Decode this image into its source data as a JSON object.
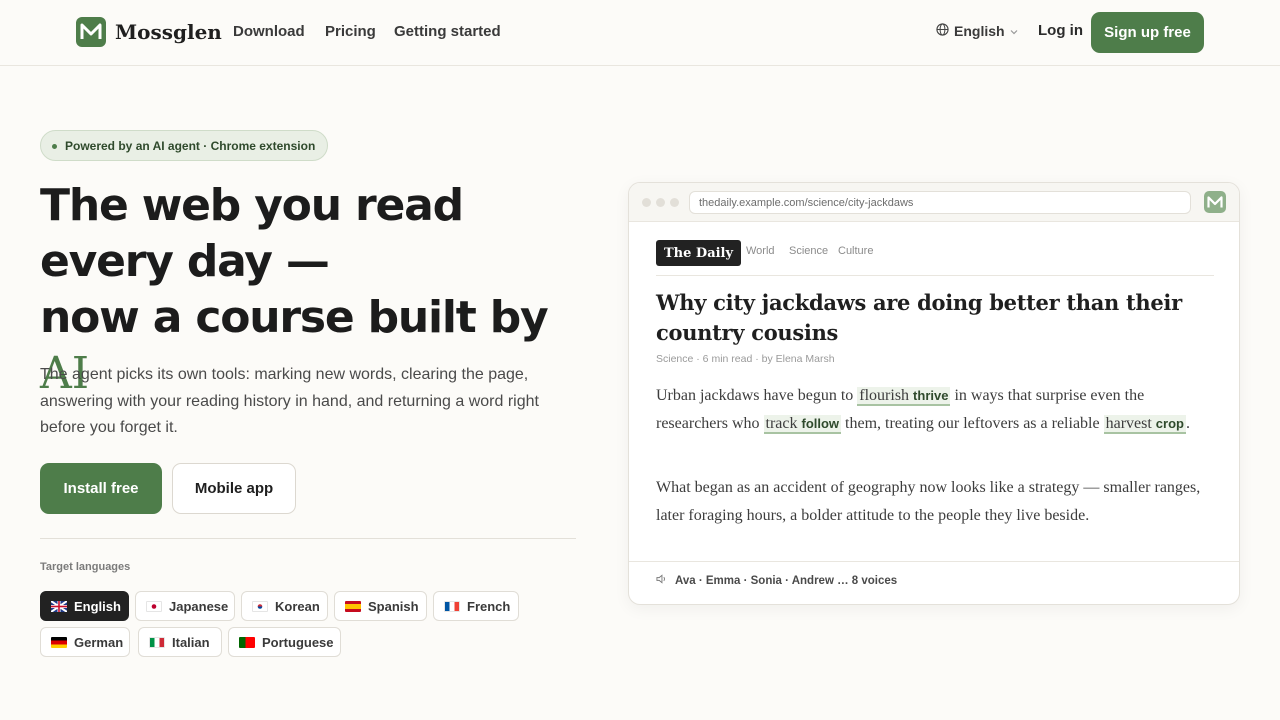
{
  "nav": {
    "brand": "Mossglen",
    "links": [
      "Download",
      "Pricing",
      "Getting started"
    ],
    "language": "English",
    "login": "Log in",
    "signup": "Sign up free"
  },
  "hero": {
    "badge": "Powered by an AI agent · Chrome extension",
    "headline_line1": "The web you read every day —",
    "headline_line2": "now a course built by",
    "headline_accent": "AI",
    "subtitle": "The agent picks its own tools: marking new words, clearing the page, answering with your reading history in hand, and returning a word right before you forget it.",
    "install_button": "Install free",
    "mobile_button": "Mobile app",
    "target_languages_label": "Target languages",
    "languages": [
      {
        "name": "English",
        "active": true
      },
      {
        "name": "Japanese",
        "active": false
      },
      {
        "name": "Korean",
        "active": false
      },
      {
        "name": "Spanish",
        "active": false
      },
      {
        "name": "French",
        "active": false
      },
      {
        "name": "German",
        "active": false
      },
      {
        "name": "Italian",
        "active": false
      },
      {
        "name": "Portuguese",
        "active": false
      }
    ]
  },
  "preview": {
    "url": "thedaily.example.com/science/city-jackdaws",
    "masthead": "The Daily",
    "sections": [
      "World",
      "Science",
      "Culture"
    ],
    "article_title": "Why city jackdaws are doing better than their country cousins",
    "byline": "Science · 6 min read · by Elena Marsh",
    "para1": {
      "t1": "Urban jackdaws have begun to ",
      "w1": "flourish",
      "g1": "thrive",
      "t2": " in ways that surprise even the researchers who ",
      "w2": "track",
      "g2": "follow",
      "t3": " them, treating our leftovers as a reliable ",
      "w3": "harvest",
      "g3": "crop",
      "t4": "."
    },
    "para2": "What began as an accident of geography now looks like a strategy — smaller ranges, later foraging hours, a bolder attitude to the people they live beside.",
    "voices": "Ava · Emma · Sonia · Andrew … 8 voices"
  },
  "colors": {
    "brand_green": "#4e7d4a",
    "background": "#fcfbf8",
    "dark_chip": "#222222"
  }
}
